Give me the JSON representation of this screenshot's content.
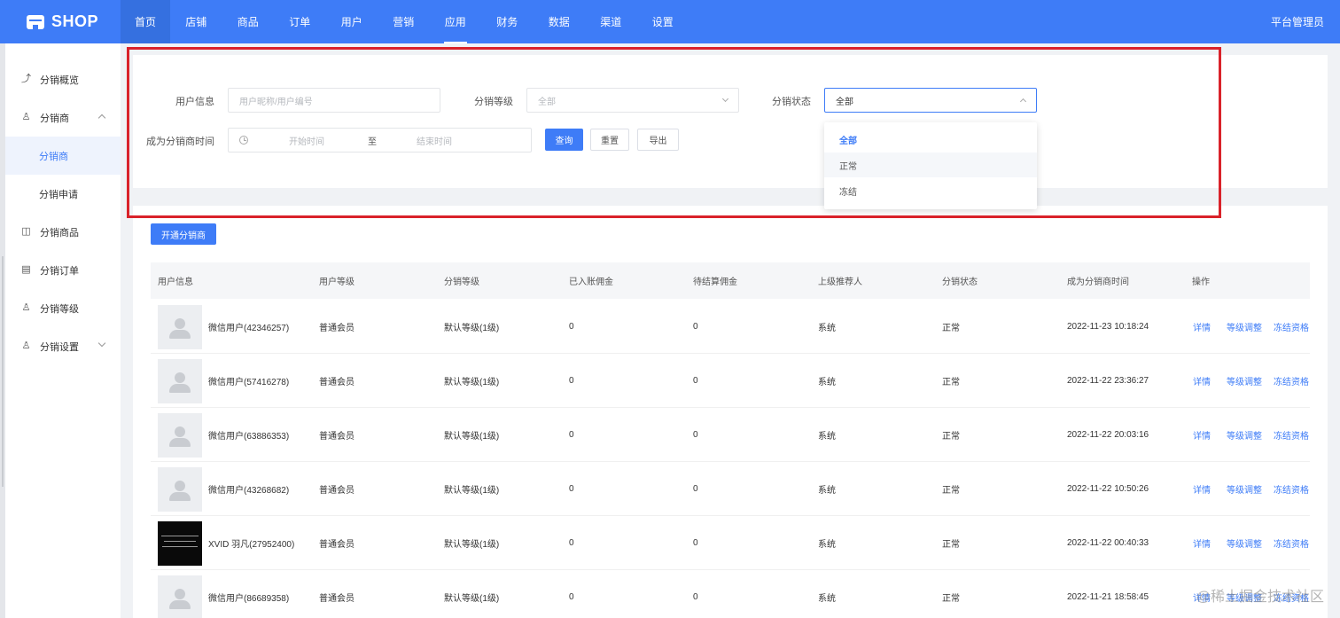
{
  "header": {
    "logo": "SHOP",
    "nav": [
      "首页",
      "店铺",
      "商品",
      "订单",
      "用户",
      "营销",
      "应用",
      "财务",
      "数据",
      "渠道",
      "设置"
    ],
    "admin": "平台管理员"
  },
  "sidebar": {
    "items": [
      {
        "label": "分销概览",
        "icon": "chart-line-icon"
      },
      {
        "label": "分销商",
        "icon": "users-icon"
      },
      {
        "label": "分销商"
      },
      {
        "label": "分销申请"
      },
      {
        "label": "分销商品",
        "icon": "box-icon"
      },
      {
        "label": "分销订单",
        "icon": "order-icon"
      },
      {
        "label": "分销等级",
        "icon": "user-level-icon"
      },
      {
        "label": "分销设置",
        "icon": "user-settings-icon"
      }
    ]
  },
  "filters": {
    "user_info_label": "用户信息",
    "user_info_placeholder": "用户昵称/用户编号",
    "level_label": "分销等级",
    "level_value": "全部",
    "status_label": "分销状态",
    "status_value": "全部",
    "time_label": "成为分销商时间",
    "start_placeholder": "开始时间",
    "range_sep": "至",
    "end_placeholder": "结束时间",
    "query_btn": "查询",
    "reset_btn": "重置",
    "export_btn": "导出"
  },
  "status_dropdown": {
    "options": [
      "全部",
      "正常",
      "冻结"
    ]
  },
  "table": {
    "open_btn": "开通分销商",
    "headers": [
      "用户信息",
      "用户等级",
      "分销等级",
      "已入账佣金",
      "待结算佣金",
      "上级推荐人",
      "分销状态",
      "成为分销商时间",
      "操作"
    ],
    "actions": [
      "详情",
      "等级调整",
      "冻结资格"
    ],
    "rows": [
      {
        "name": "微信用户(42346257)",
        "user_level": "普通会员",
        "dist_level": "默认等级(1级)",
        "booked": "0",
        "pending": "0",
        "referrer": "系统",
        "status": "正常",
        "time": "2022-11-23 10:18:24"
      },
      {
        "name": "微信用户(57416278)",
        "user_level": "普通会员",
        "dist_level": "默认等级(1级)",
        "booked": "0",
        "pending": "0",
        "referrer": "系统",
        "status": "正常",
        "time": "2022-11-22 23:36:27"
      },
      {
        "name": "微信用户(63886353)",
        "user_level": "普通会员",
        "dist_level": "默认等级(1级)",
        "booked": "0",
        "pending": "0",
        "referrer": "系统",
        "status": "正常",
        "time": "2022-11-22 20:03:16"
      },
      {
        "name": "微信用户(43268682)",
        "user_level": "普通会员",
        "dist_level": "默认等级(1级)",
        "booked": "0",
        "pending": "0",
        "referrer": "系统",
        "status": "正常",
        "time": "2022-11-22 10:50:26"
      },
      {
        "name": "XVID 羽凡(27952400)",
        "user_level": "普通会员",
        "dist_level": "默认等级(1级)",
        "booked": "0",
        "pending": "0",
        "referrer": "系统",
        "status": "正常",
        "time": "2022-11-22 00:40:33"
      },
      {
        "name": "微信用户(86689358)",
        "user_level": "普通会员",
        "dist_level": "默认等级(1级)",
        "booked": "0",
        "pending": "0",
        "referrer": "系统",
        "status": "正常",
        "time": "2022-11-21 18:58:45"
      }
    ]
  },
  "watermark": "@稀土掘金技术社区",
  "colors": {
    "primary": "#3e7cf7",
    "highlight": "#d9222a"
  }
}
